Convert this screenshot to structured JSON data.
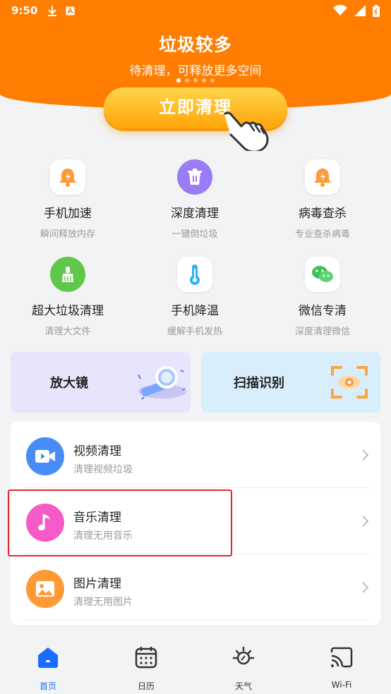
{
  "status_bar": {
    "time": "9:50"
  },
  "hero": {
    "title": "垃圾较多",
    "subtitle": "待清理，可释放更多空间",
    "button_label": "立即清理",
    "page_indicator": {
      "count": 5,
      "active": 1
    }
  },
  "features": [
    {
      "name": "手机加速",
      "desc": "瞬间释放内存",
      "icon": "bell-bolt-icon"
    },
    {
      "name": "深度清理",
      "desc": "一键倒垃圾",
      "icon": "trash-icon"
    },
    {
      "name": "病毒查杀",
      "desc": "专业查杀病毒",
      "icon": "bell-bolt-icon"
    },
    {
      "name": "超大垃圾清理",
      "desc": "清理大文件",
      "icon": "broom-icon"
    },
    {
      "name": "手机降温",
      "desc": "缓解手机发热",
      "icon": "thermometer-icon"
    },
    {
      "name": "微信专清",
      "desc": "深度清理微信",
      "icon": "wechat-icon"
    }
  ],
  "cards": {
    "magnifier": {
      "label": "放大镜",
      "icon": "magnifier-icon"
    },
    "scan": {
      "label": "扫描识别",
      "icon": "scan-eye-icon"
    }
  },
  "list": [
    {
      "title": "视频清理",
      "sub": "清理视频垃圾",
      "icon": "video-icon",
      "color": "#4a8cf7"
    },
    {
      "title": "音乐清理",
      "sub": "清理无用音乐",
      "icon": "music-note-icon",
      "color": "#f65ac6"
    },
    {
      "title": "图片清理",
      "sub": "清理无用图片",
      "icon": "image-icon",
      "color": "#ff9a36"
    }
  ],
  "nav": [
    {
      "label": "首页",
      "icon": "home-icon",
      "active": true
    },
    {
      "label": "日历",
      "icon": "calendar-icon",
      "active": false
    },
    {
      "label": "天气",
      "icon": "weather-sun-icon",
      "active": false
    },
    {
      "label": "Wi-Fi",
      "icon": "cast-wifi-icon",
      "active": false
    }
  ],
  "colors": {
    "brand": "#ff7d00",
    "accent_blue": "#1a6cff",
    "highlight_border": "#e3262e"
  }
}
